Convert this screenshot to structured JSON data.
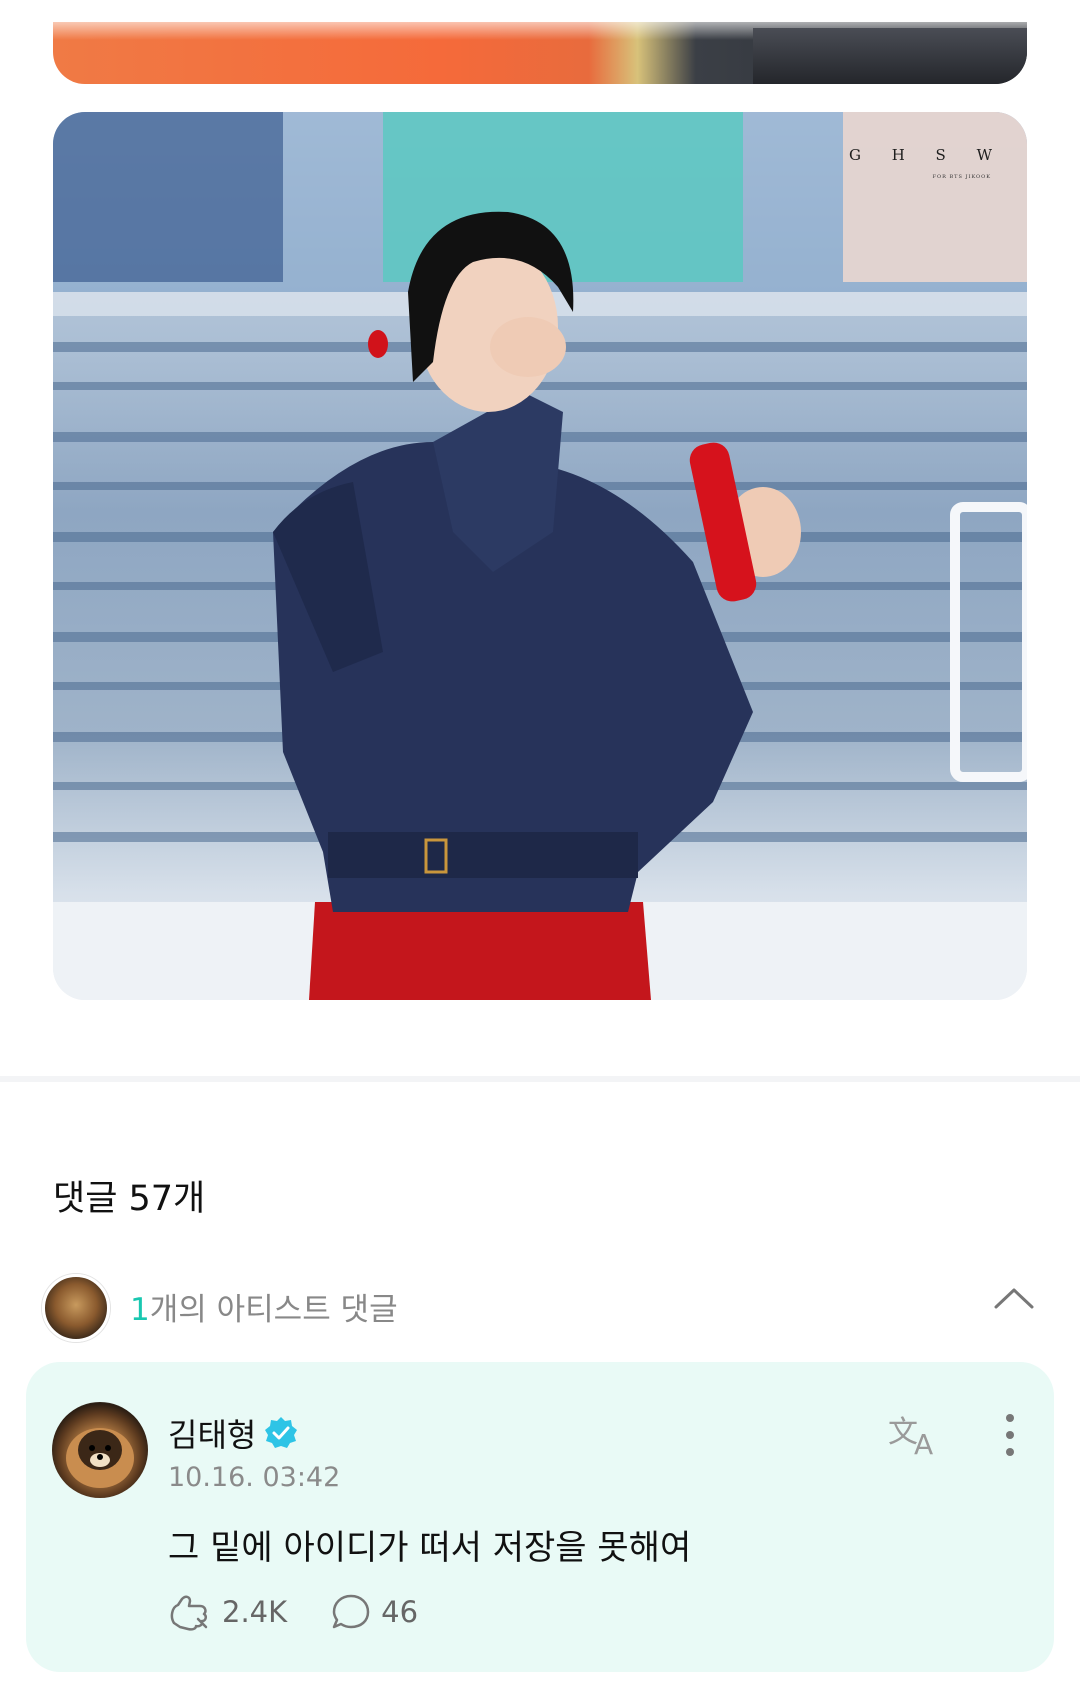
{
  "post": {
    "watermark": "G H S W",
    "watermark_sub": "FOR BTS JIKOOK"
  },
  "comments": {
    "title": "댓글 57개",
    "artist_summary": {
      "count": "1",
      "label": "개의 아티스트 댓글"
    },
    "artist_comment": {
      "author": "김태형",
      "verified": true,
      "timestamp": "10.16. 03:42",
      "text": "그 밑에 아이디가 떠서 저장을 못해여",
      "likes": "2.4K",
      "replies": "46"
    }
  },
  "colors": {
    "accent": "#19c7b0",
    "card_background": "#e9faf6",
    "verified_badge": "#2ec4e6",
    "divider": "#f3f4f6"
  },
  "icons": [
    "chevron-up-icon",
    "translate-icon",
    "more-vertical-icon",
    "verified-badge-icon",
    "like-icon",
    "reply-icon"
  ]
}
